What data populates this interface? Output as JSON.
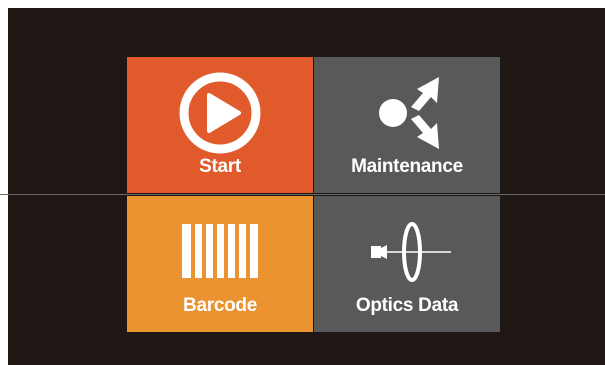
{
  "colors": {
    "start": "#e05a2b",
    "maintenance": "#58595b",
    "barcode": "#ea9330",
    "optics": "#58595b"
  },
  "tiles": [
    {
      "key": "start",
      "label": "Start",
      "icon": "play-icon"
    },
    {
      "key": "maintenance",
      "label": "Maintenance",
      "icon": "maintenance-icon"
    },
    {
      "key": "barcode",
      "label": "Barcode",
      "icon": "barcode-icon"
    },
    {
      "key": "optics",
      "label": "Optics Data",
      "icon": "optics-icon"
    }
  ]
}
